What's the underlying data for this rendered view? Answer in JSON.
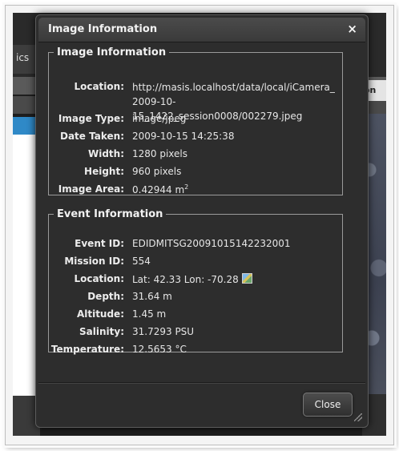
{
  "background": {
    "left_tab_fragment": "ics",
    "right_button_fragment": "on"
  },
  "dialog": {
    "title": "Image Information",
    "close_icon": "×",
    "image_info": {
      "legend": "Image Information",
      "location_label": "Location:",
      "location_value": "http://masis.localhost/data/local/iCamera_ 2009-10-15_1422_session0008/002279.jpeg",
      "type_label": "Image Type:",
      "type_value": "image/jpeg",
      "date_label": "Date Taken:",
      "date_value": "2009-10-15 14:25:38",
      "width_label": "Width:",
      "width_value": "1280 pixels",
      "height_label": "Height:",
      "height_value": "960 pixels",
      "area_label": "Image Area:",
      "area_value": "0.42944 m",
      "area_unit_sup": "2"
    },
    "event_info": {
      "legend": "Event Information",
      "event_id_label": "Event ID:",
      "event_id_value": "EDIDMITSG20091015142232001",
      "mission_id_label": "Mission ID:",
      "mission_id_value": "554",
      "location_label": "Location:",
      "location_value": "Lat: 42.33 Lon: -70.28",
      "depth_label": "Depth:",
      "depth_value": "31.64 m",
      "altitude_label": "Altitude:",
      "altitude_value": "1.45 m",
      "salinity_label": "Salinity:",
      "salinity_value": "31.7293 PSU",
      "temperature_label": "Temperature:",
      "temperature_value": "12.5653 °C"
    },
    "close_button": "Close"
  },
  "icons": {
    "close": "close-icon",
    "map": "map-icon",
    "resize": "resize-grip-icon"
  },
  "colors": {
    "dialog_bg": "#2d2d2d",
    "titlebar": "#444444",
    "accent_blue": "#2f89c7"
  }
}
